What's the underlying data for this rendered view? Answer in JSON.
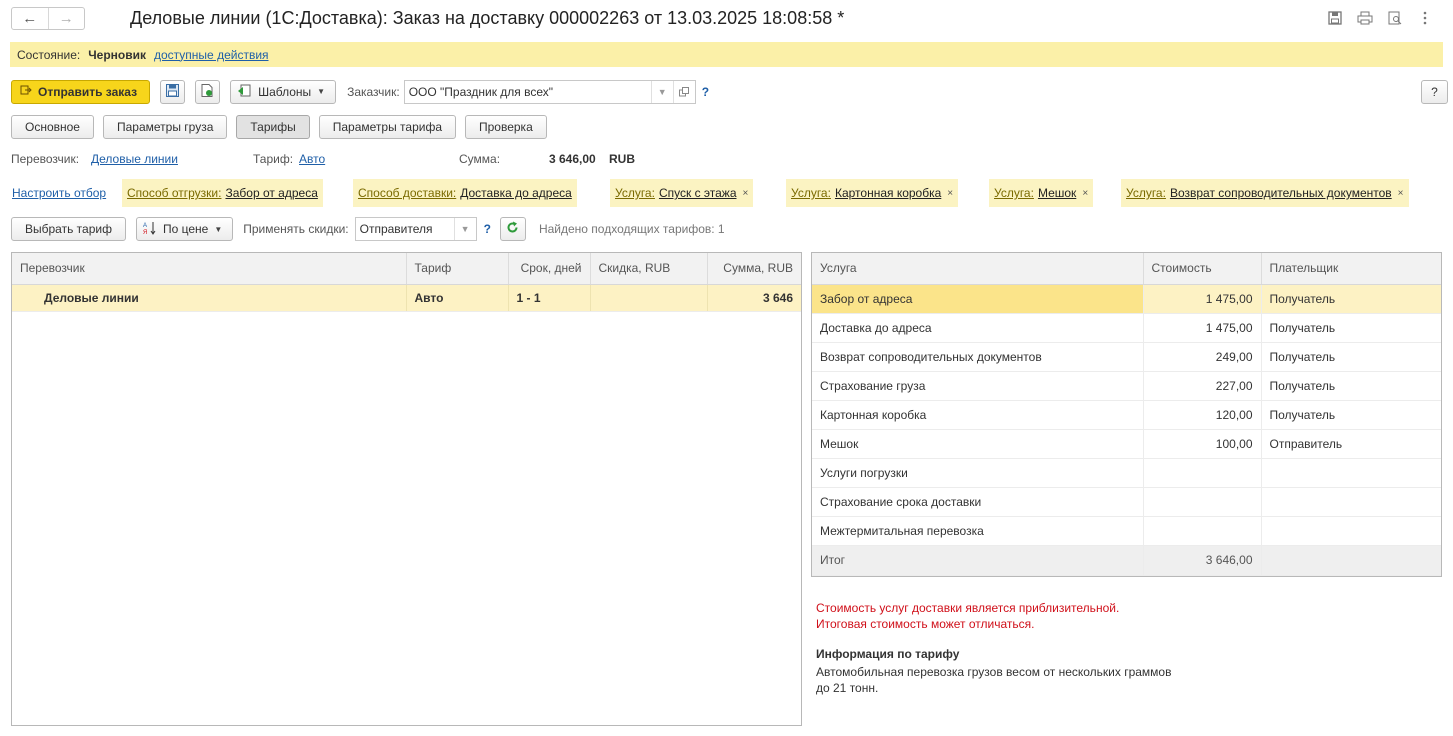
{
  "window": {
    "title": "Деловые линии (1С:Доставка): Заказ на доставку 000002263 от 13.03.2025 18:08:58 *",
    "nav_back": "←",
    "nav_forward": "→"
  },
  "state": {
    "label": "Состояние:",
    "value": "Черновик",
    "actions_link": "доступные действия"
  },
  "toolbar": {
    "send_label": "Отправить заказ",
    "templates_label": "Шаблоны",
    "customer_label": "Заказчик:",
    "customer_value": "ООО \"Праздник для всех\"",
    "help_mark": "?",
    "help_button": "?"
  },
  "tabs": [
    {
      "label": "Основное"
    },
    {
      "label": "Параметры груза"
    },
    {
      "label": "Тарифы"
    },
    {
      "label": "Параметры тарифа"
    },
    {
      "label": "Проверка"
    }
  ],
  "summary": {
    "carrier_label": "Перевозчик:",
    "carrier_value": "Деловые линии",
    "tariff_label": "Тариф:",
    "tariff_value": "Авто",
    "sum_label": "Сумма:",
    "sum_value": "3 646,00",
    "currency": "RUB"
  },
  "filters": {
    "setup_link": "Настроить отбор",
    "chips": [
      {
        "key": "Способ отгрузки:",
        "value": "Забор от адреса",
        "removable": ""
      },
      {
        "key": "Способ доставки:",
        "value": "Доставка до адреса",
        "removable": ""
      },
      {
        "key": "Услуга:",
        "value": "Спуск с этажа",
        "removable": "×"
      },
      {
        "key": "Услуга:",
        "value": "Картонная коробка",
        "removable": "×"
      },
      {
        "key": "Услуга:",
        "value": "Мешок",
        "removable": "×"
      },
      {
        "key": "Услуга:",
        "value": "Возврат сопроводительных документов",
        "removable": "×"
      }
    ]
  },
  "controls": {
    "choose_tariff": "Выбрать тариф",
    "sort_label": "По цене",
    "discount_label": "Применять скидки:",
    "discount_value": "Отправителя",
    "help_mark": "?",
    "found_text": "Найдено подходящих тарифов: 1"
  },
  "tariff_table": {
    "headers": [
      "Перевозчик",
      "Тариф",
      "Срок, дней",
      "Скидка, RUB",
      "Сумма, RUB"
    ],
    "rows": [
      {
        "carrier": "Деловые линии",
        "tariff": "Авто",
        "days": "1 - 1",
        "discount": "",
        "sum": "3 646"
      }
    ]
  },
  "services_table": {
    "headers": [
      "Услуга",
      "Стоимость",
      "Плательщик"
    ],
    "rows": [
      {
        "service": "Забор от адреса",
        "cost": "1 475,00",
        "payer": "Получатель"
      },
      {
        "service": "Доставка до адреса",
        "cost": "1 475,00",
        "payer": "Получатель"
      },
      {
        "service": "Возврат сопроводительных документов",
        "cost": "249,00",
        "payer": "Получатель"
      },
      {
        "service": "Страхование груза",
        "cost": "227,00",
        "payer": "Получатель"
      },
      {
        "service": "Картонная коробка",
        "cost": "120,00",
        "payer": "Получатель"
      },
      {
        "service": "Мешок",
        "cost": "100,00",
        "payer": "Отправитель"
      },
      {
        "service": "Услуги погрузки",
        "cost": "",
        "payer": ""
      },
      {
        "service": "Страхование срока доставки",
        "cost": "",
        "payer": ""
      },
      {
        "service": "Межтермитальная перевозка",
        "cost": "",
        "payer": ""
      }
    ],
    "total_label": "Итог",
    "total_value": "3 646,00"
  },
  "notes": {
    "warning_line1": "Стоимость услуг доставки является приблизительной.",
    "warning_line2": "Итоговая стоимость может отличаться.",
    "info_title": "Информация по тарифу",
    "info_text": "Автомобильная перевозка грузов весом от нескольких граммов до 21 тонн."
  },
  "colors": {
    "accent_yellow": "#f7d51b",
    "state_bar": "#fbf0a8",
    "selection": "#fdf2c4",
    "link": "#1f5fa8",
    "warning": "#d0101a"
  }
}
